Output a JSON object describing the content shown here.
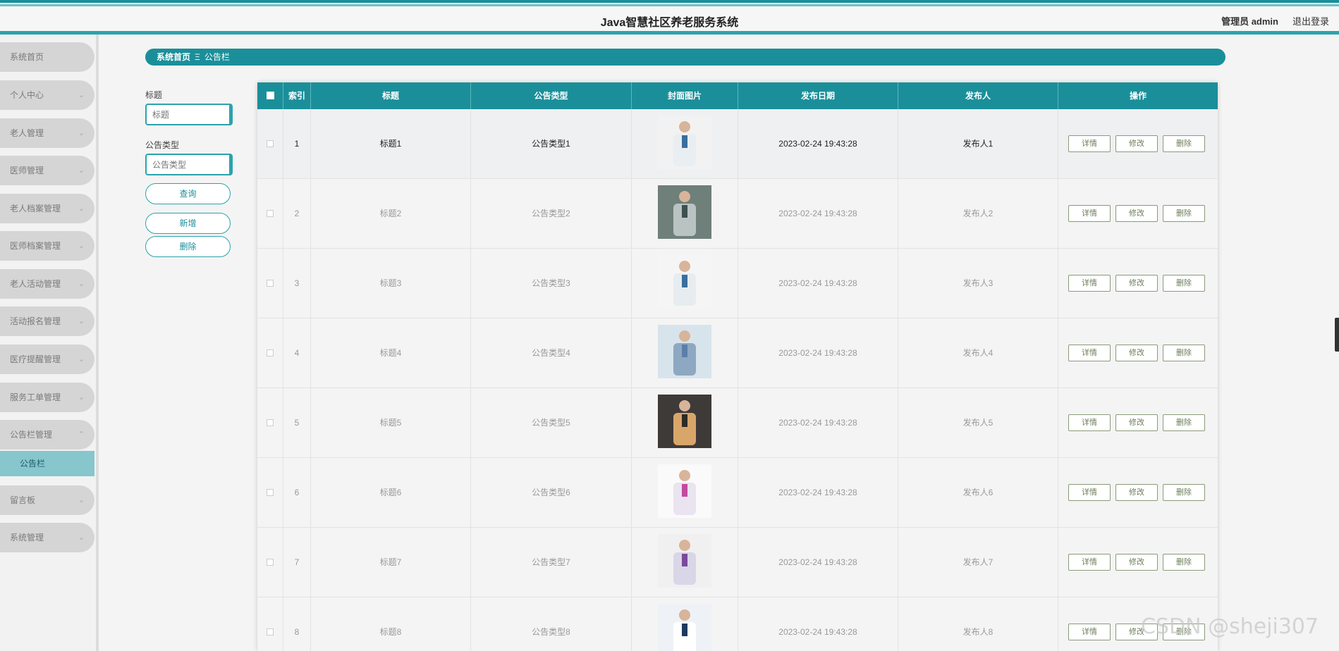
{
  "header": {
    "title": "Java智慧社区养老服务系统",
    "admin_label": "管理员 admin",
    "logout_label": "退出登录"
  },
  "sidebar": {
    "items": [
      {
        "label": "系统首页",
        "chevron": ""
      },
      {
        "label": "个人中心",
        "chevron": "⌄"
      },
      {
        "label": "老人管理",
        "chevron": "⌄"
      },
      {
        "label": "医师管理",
        "chevron": "⌄"
      },
      {
        "label": "老人档案管理",
        "chevron": "⌄"
      },
      {
        "label": "医师档案管理",
        "chevron": "⌄"
      },
      {
        "label": "老人活动管理",
        "chevron": "⌄"
      },
      {
        "label": "活动报名管理",
        "chevron": "⌄"
      },
      {
        "label": "医疗提醒管理",
        "chevron": "⌄"
      },
      {
        "label": "服务工单管理",
        "chevron": "⌄"
      },
      {
        "label": "公告栏管理",
        "chevron": "⌃"
      },
      {
        "label": "留言板",
        "chevron": "⌄"
      },
      {
        "label": "系统管理",
        "chevron": "⌄"
      }
    ],
    "active_sub": "公告栏"
  },
  "breadcrumb": {
    "home": "系统首页",
    "separator": "Ξ",
    "current": "公告栏"
  },
  "search": {
    "title_label": "标题",
    "title_placeholder": "标题",
    "type_label": "公告类型",
    "type_placeholder": "公告类型",
    "query_button": "查询",
    "add_button": "新增",
    "delete_button": "删除"
  },
  "table": {
    "headers": [
      "索引",
      "标题",
      "公告类型",
      "封面图片",
      "发布日期",
      "发布人",
      "操作"
    ],
    "actions": {
      "detail": "详情",
      "edit": "修改",
      "delete": "删除"
    },
    "rows": [
      {
        "index": "1",
        "title": "标题1",
        "type": "公告类型1",
        "date": "2023-02-24 19:43:28",
        "publisher": "发布人1"
      },
      {
        "index": "2",
        "title": "标题2",
        "type": "公告类型2",
        "date": "2023-02-24 19:43:28",
        "publisher": "发布人2"
      },
      {
        "index": "3",
        "title": "标题3",
        "type": "公告类型3",
        "date": "2023-02-24 19:43:28",
        "publisher": "发布人3"
      },
      {
        "index": "4",
        "title": "标题4",
        "type": "公告类型4",
        "date": "2023-02-24 19:43:28",
        "publisher": "发布人4"
      },
      {
        "index": "5",
        "title": "标题5",
        "type": "公告类型5",
        "date": "2023-02-24 19:43:28",
        "publisher": "发布人5"
      },
      {
        "index": "6",
        "title": "标题6",
        "type": "公告类型6",
        "date": "2023-02-24 19:43:28",
        "publisher": "发布人6"
      },
      {
        "index": "7",
        "title": "标题7",
        "type": "公告类型7",
        "date": "2023-02-24 19:43:28",
        "publisher": "发布人7"
      },
      {
        "index": "8",
        "title": "标题8",
        "type": "公告类型8",
        "date": "2023-02-24 19:43:28",
        "publisher": "发布人8"
      }
    ]
  },
  "watermark": "CSDN @sheji307",
  "colors": {
    "accent": "#1a8f9a",
    "sidebar_active": "#86c6cc",
    "menu_bg": "#d5d5d5"
  }
}
